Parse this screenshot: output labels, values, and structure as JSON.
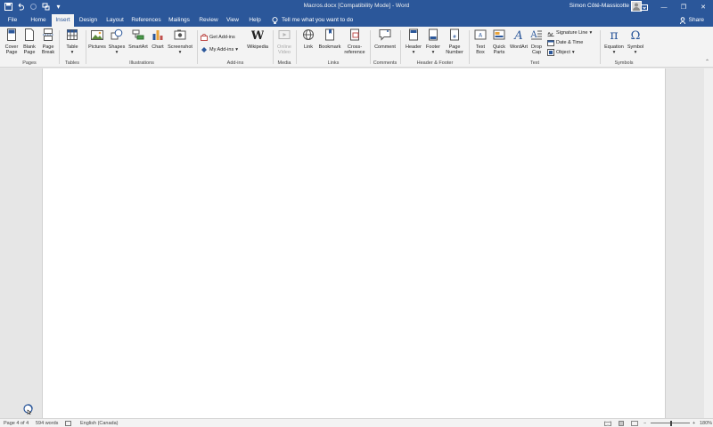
{
  "window": {
    "title": "Macros.docx [Compatibility Mode]  -  Word",
    "user_name": "Simon Côté-Massicotte",
    "minimize_label": "—",
    "restore_label": "❐",
    "close_label": "✕"
  },
  "quick_access": {
    "save_icon": "save-icon",
    "undo_icon": "undo-icon",
    "redo_icon": "redo-icon",
    "touch_icon": "touch-mode-icon",
    "customize_icon": "customize-icon"
  },
  "tabs": [
    {
      "label": "File"
    },
    {
      "label": "Home"
    },
    {
      "label": "Insert",
      "active": true
    },
    {
      "label": "Design"
    },
    {
      "label": "Layout"
    },
    {
      "label": "References"
    },
    {
      "label": "Mailings"
    },
    {
      "label": "Review"
    },
    {
      "label": "View"
    },
    {
      "label": "Help"
    }
  ],
  "tell_me": "Tell me what you want to do",
  "share": "Share",
  "ribbon": {
    "pages": {
      "label": "Pages",
      "cover_page": "Cover\nPage",
      "blank_page": "Blank\nPage",
      "page_break": "Page\nBreak"
    },
    "tables": {
      "label": "Tables",
      "table": "Table"
    },
    "illustrations": {
      "label": "Illustrations",
      "pictures": "Pictures",
      "shapes": "Shapes",
      "smartart": "SmartArt",
      "chart": "Chart",
      "screenshot": "Screenshot"
    },
    "addins": {
      "label": "Add-ins",
      "get_addins": "Get Add-ins",
      "my_addins": "My Add-ins",
      "wikipedia": "Wikipedia"
    },
    "media": {
      "label": "Media",
      "online_video": "Online\nVideo"
    },
    "links": {
      "label": "Links",
      "link": "Link",
      "bookmark": "Bookmark",
      "cross_reference": "Cross-\nreference"
    },
    "comments": {
      "label": "Comments",
      "comment": "Comment"
    },
    "header_footer": {
      "label": "Header & Footer",
      "header": "Header",
      "footer": "Footer",
      "page_number": "Page\nNumber"
    },
    "text": {
      "label": "Text",
      "text_box": "Text\nBox",
      "quick_parts": "Quick\nParts",
      "wordart": "WordArt",
      "drop_cap": "Drop\nCap",
      "signature_line": "Signature Line",
      "date_time": "Date & Time",
      "object": "Object"
    },
    "symbols": {
      "label": "Symbols",
      "equation": "Equation",
      "symbol": "Symbol"
    }
  },
  "status": {
    "page": "Page 4 of 4",
    "words": "594 words",
    "language": "English (Canada)",
    "zoom": "180%"
  },
  "colors": {
    "brand": "#2b579a",
    "ribbon_bg": "#f3f3f3",
    "canvas_bg": "#e6e6e6"
  }
}
